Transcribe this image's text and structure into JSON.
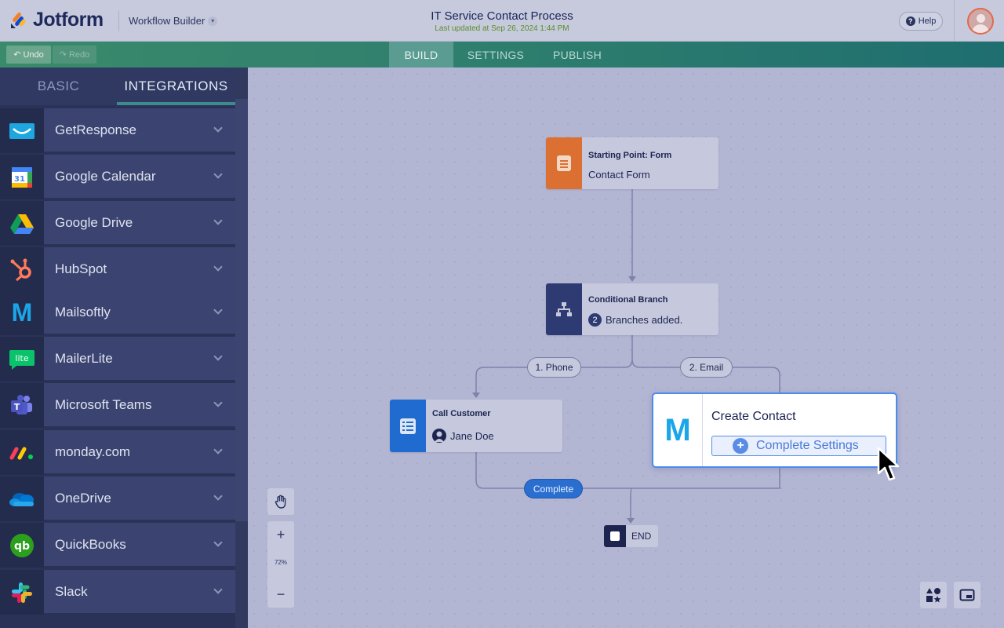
{
  "header": {
    "logo_text": "Jotform",
    "app_name": "Workflow Builder",
    "title": "IT Service Contact Process",
    "subtitle": "Last updated at Sep 26, 2024 1:44 PM",
    "help_label": "Help"
  },
  "toolbar": {
    "undo_label": "Undo",
    "redo_label": "Redo",
    "tabs": [
      {
        "label": "BUILD",
        "active": true
      },
      {
        "label": "SETTINGS",
        "active": false
      },
      {
        "label": "PUBLISH",
        "active": false
      }
    ]
  },
  "sidebar": {
    "tabs": [
      {
        "label": "BASIC",
        "active": false
      },
      {
        "label": "INTEGRATIONS",
        "active": true
      }
    ],
    "items": [
      {
        "label": "GetResponse",
        "icon": "getresponse-icon"
      },
      {
        "label": "Google Calendar",
        "icon": "google-calendar-icon"
      },
      {
        "label": "Google Drive",
        "icon": "google-drive-icon"
      },
      {
        "label": "HubSpot",
        "icon": "hubspot-icon"
      },
      {
        "label": "Mailsoftly",
        "icon": "mailsoftly-icon"
      },
      {
        "label": "MailerLite",
        "icon": "mailerlite-icon"
      },
      {
        "label": "Microsoft Teams",
        "icon": "microsoft-teams-icon"
      },
      {
        "label": "monday.com",
        "icon": "monday-icon"
      },
      {
        "label": "OneDrive",
        "icon": "onedrive-icon"
      },
      {
        "label": "QuickBooks",
        "icon": "quickbooks-icon"
      },
      {
        "label": "Slack",
        "icon": "slack-icon"
      }
    ]
  },
  "flow": {
    "start": {
      "title": "Starting Point: Form",
      "sub": "Contact Form"
    },
    "branch": {
      "title": "Conditional Branch",
      "count": "2",
      "sub": "Branches added."
    },
    "branch_labels": [
      "1. Phone",
      "2. Email"
    ],
    "call": {
      "title": "Call Customer",
      "sub": "Jane Doe"
    },
    "create": {
      "icon_letter": "M",
      "title": "Create Contact",
      "button": "Complete Settings"
    },
    "complete_label": "Complete",
    "end_label": "END"
  },
  "zoom": {
    "level": "72%",
    "plus": "+",
    "minus": "−"
  },
  "colors": {
    "start_icon": "#dc7033",
    "branch_icon": "#2e3a72",
    "call_icon": "#1f6bd0",
    "accent_blue": "#4a8bee",
    "mailsoftly": "#1aa6e8"
  }
}
